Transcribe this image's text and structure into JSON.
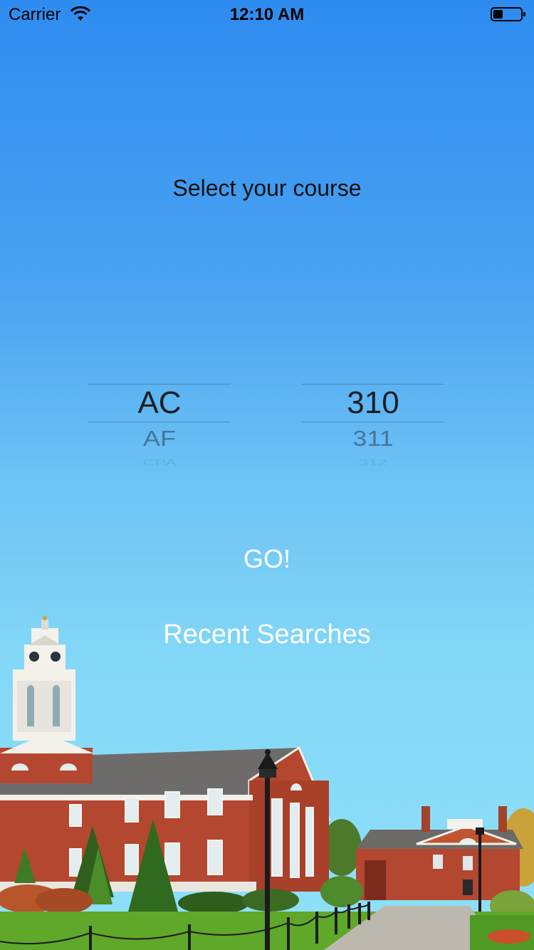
{
  "status_bar": {
    "carrier": "Carrier",
    "time": "12:10 AM"
  },
  "main": {
    "title": "Select your course",
    "picker_subject": {
      "selected": "AC",
      "next": "AF",
      "faded": "CPA"
    },
    "picker_number": {
      "selected": "310",
      "next": "311",
      "faded": "312"
    },
    "go_label": "GO!",
    "recent_label": "Recent Searches"
  },
  "colors": {
    "sky_top": "#2e8cf0",
    "sky_bottom": "#8fe0f8",
    "brick": "#b4472f",
    "grass": "#5fa82a"
  }
}
